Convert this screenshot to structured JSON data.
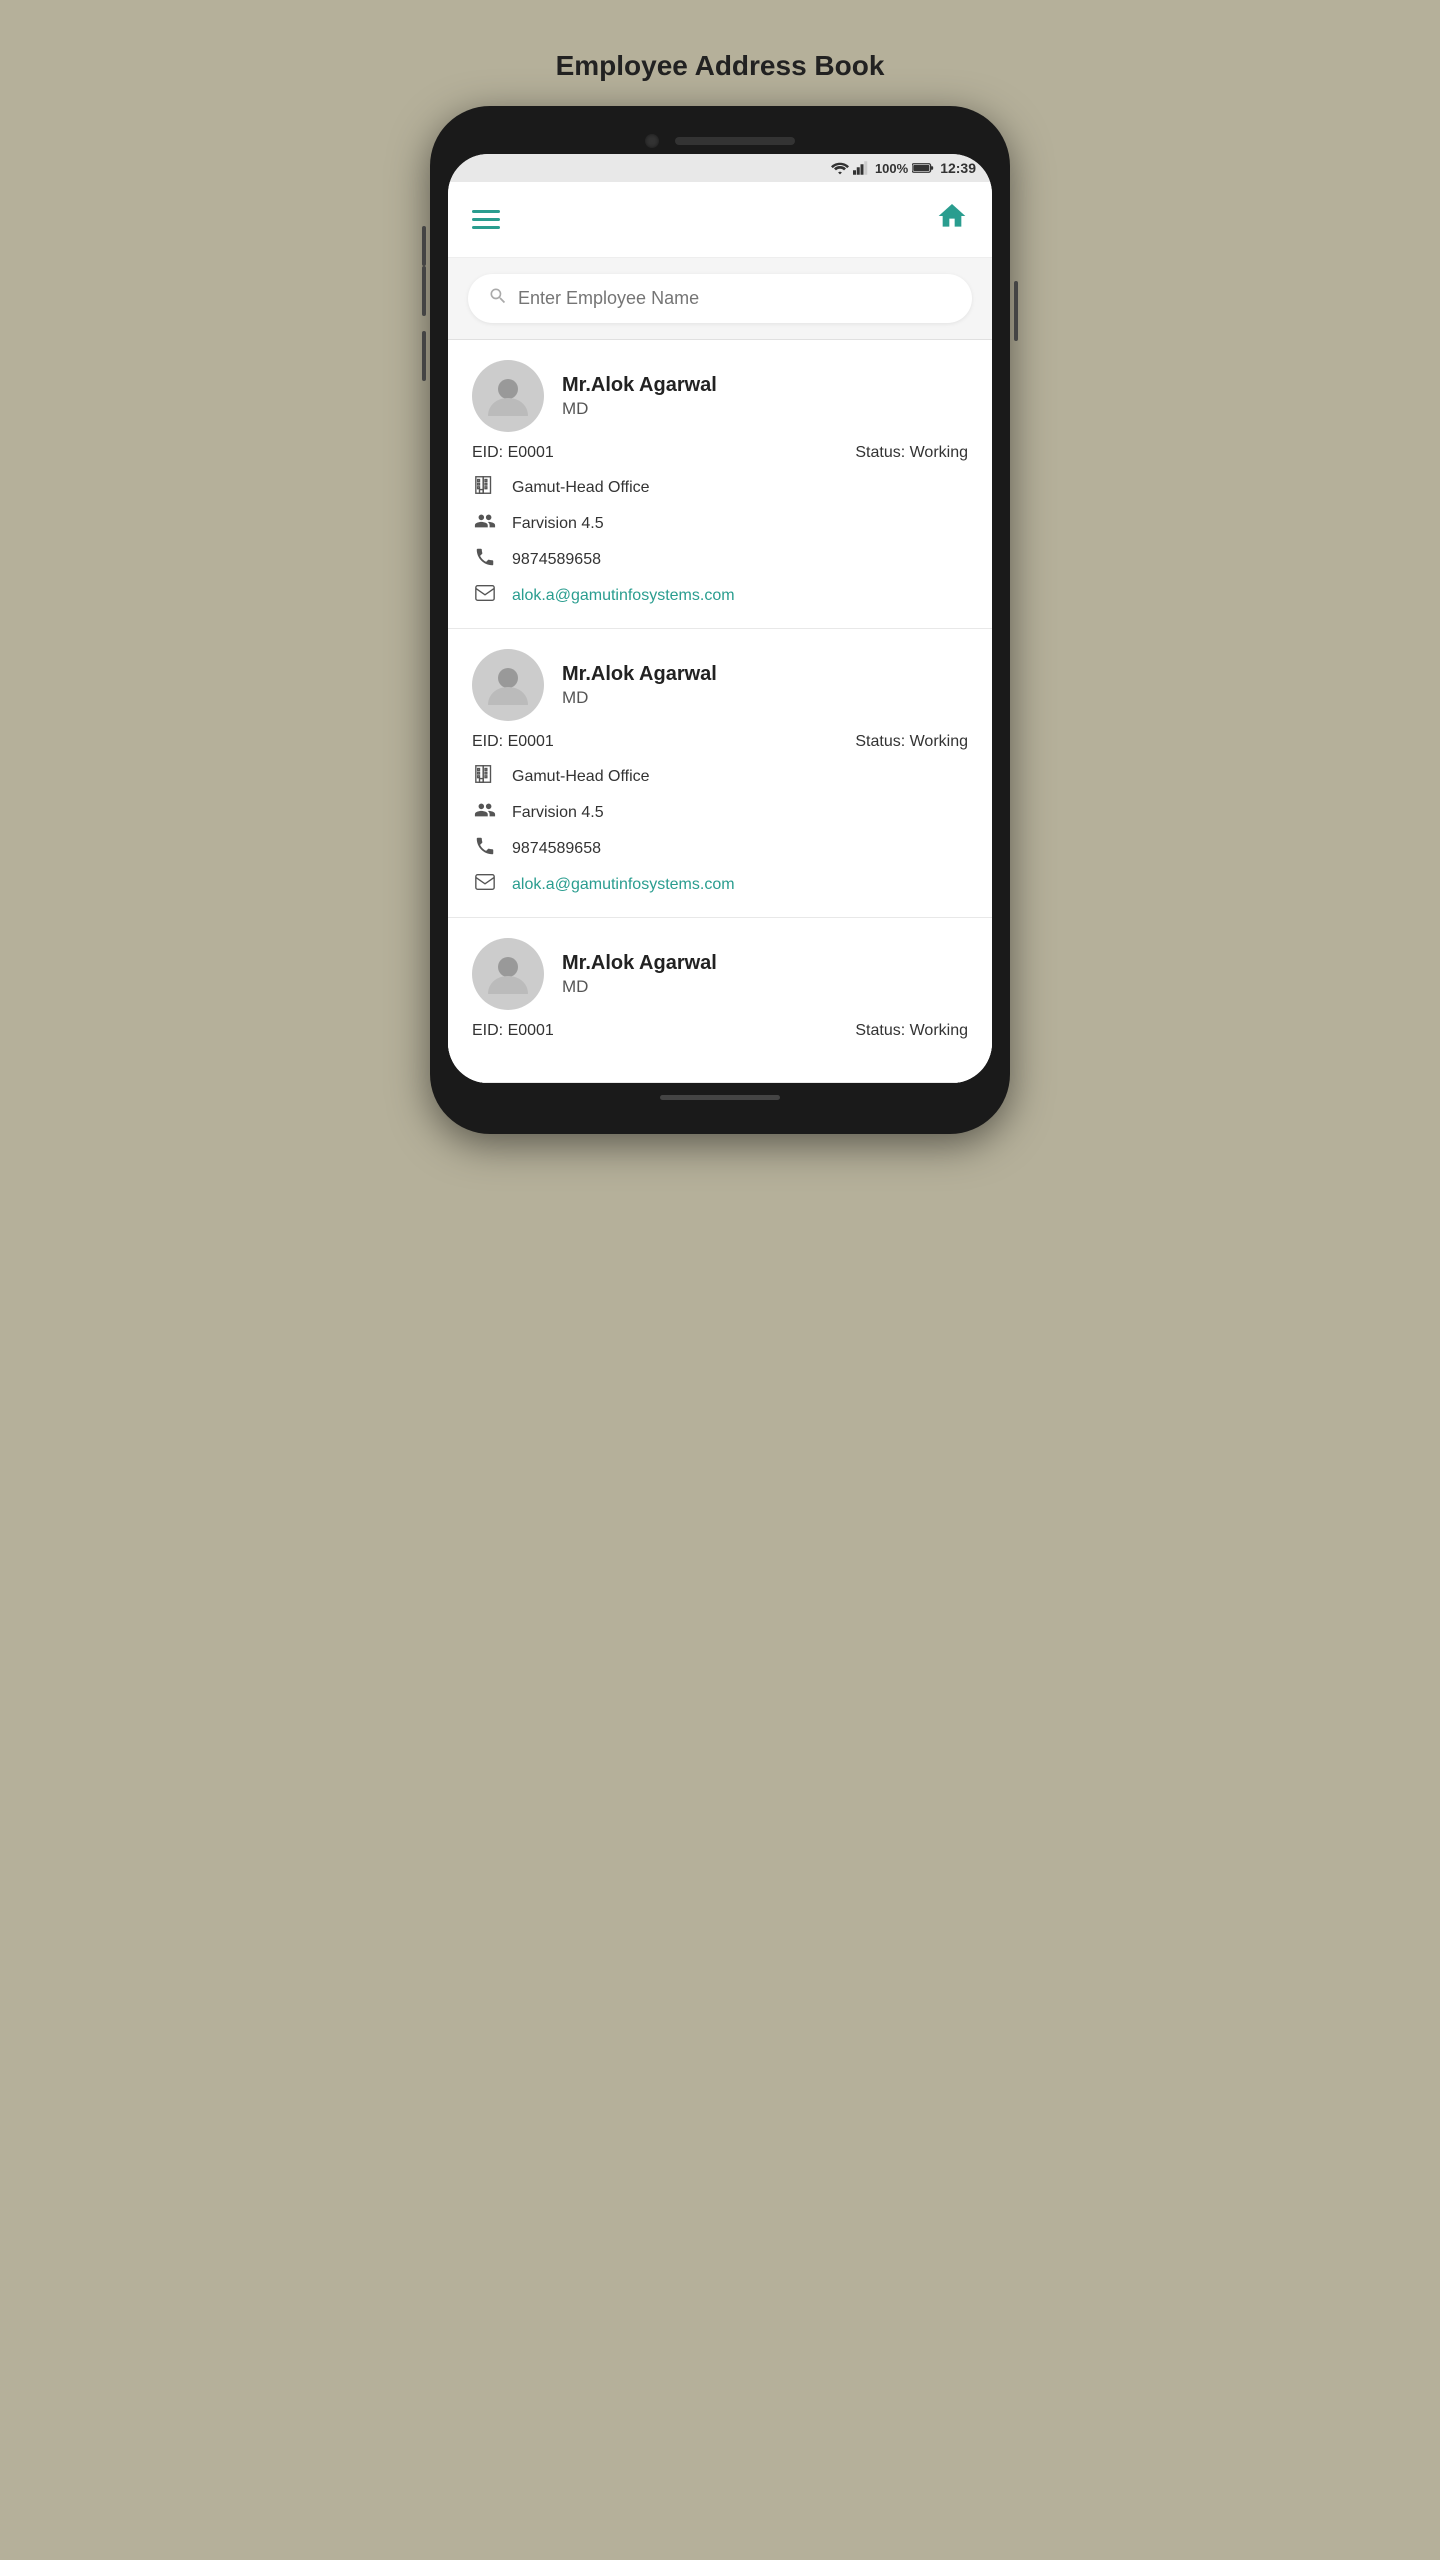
{
  "page": {
    "title": "Employee Address Book"
  },
  "status_bar": {
    "time": "12:39",
    "battery": "100%"
  },
  "search": {
    "placeholder": "Enter Employee Name"
  },
  "employees": [
    {
      "name": "Mr.Alok Agarwal",
      "role": "MD",
      "eid": "EID: E0001",
      "status": "Status: Working",
      "office": "Gamut-Head Office",
      "department": "Farvision 4.5",
      "phone": "9874589658",
      "email": "alok.a@gamutinfosystems.com"
    },
    {
      "name": "Mr.Alok Agarwal",
      "role": "MD",
      "eid": "EID: E0001",
      "status": "Status: Working",
      "office": "Gamut-Head Office",
      "department": "Farvision 4.5",
      "phone": "9874589658",
      "email": "alok.a@gamutinfosystems.com"
    },
    {
      "name": "Mr.Alok Agarwal",
      "role": "MD",
      "eid": "EID: E0001",
      "status": "Status: Working",
      "office": "",
      "department": "",
      "phone": "",
      "email": ""
    }
  ],
  "nav": {
    "hamburger_label": "Menu",
    "home_label": "Home"
  }
}
